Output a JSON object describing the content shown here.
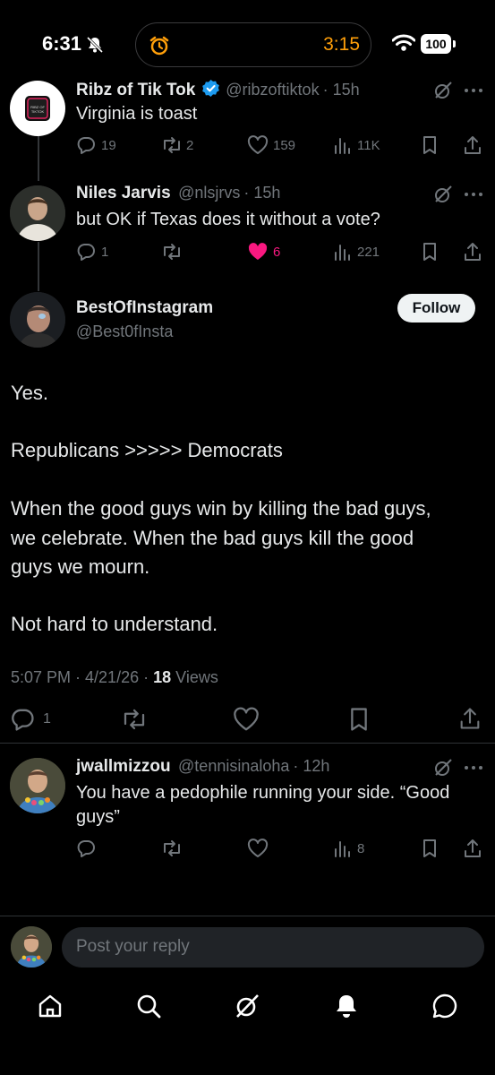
{
  "status_bar": {
    "time": "6:31",
    "timer": "3:15",
    "battery": "100"
  },
  "tweets": [
    {
      "name": "Ribz of Tik Tok",
      "handle": "@ribzoftiktok",
      "time": "· 15h",
      "text": "Virginia is toast",
      "replies": "19",
      "reposts": "2",
      "likes": "159",
      "views": "11K",
      "avatar_label": "RIBZ OF TIKTOK"
    },
    {
      "name": "Niles Jarvis",
      "handle": "@nlsjrvs",
      "time": "· 15h",
      "text": "but OK if Texas does it without a vote?",
      "replies": "1",
      "reposts": "",
      "likes": "6",
      "views": "221"
    }
  ],
  "main_post": {
    "name": "BestOfInstagram",
    "handle": "@Best0fInsta",
    "follow_label": "Follow",
    "lines": [
      "Yes.",
      "Republicans >>>>> Democrats",
      "When the good guys win by killing the bad guys,",
      "we celebrate. When the bad guys kill the good",
      "guys we mourn.",
      "Not hard to understand."
    ],
    "timestamp": "5:07 PM · 4/21/26 ·",
    "views_count": "18",
    "views_label": "Views",
    "replies": "1"
  },
  "reply": {
    "name": "jwallmizzou",
    "handle": "@tennisinaloha",
    "time": "· 12h",
    "line1": "You have a pedophile running your side. “Good",
    "line2": "guys”",
    "views": "8"
  },
  "composer": {
    "placeholder": "Post your reply"
  },
  "colors": {
    "like_active": "#f91880",
    "verified": "#1d9bf0",
    "timer": "#ff9f0a"
  }
}
